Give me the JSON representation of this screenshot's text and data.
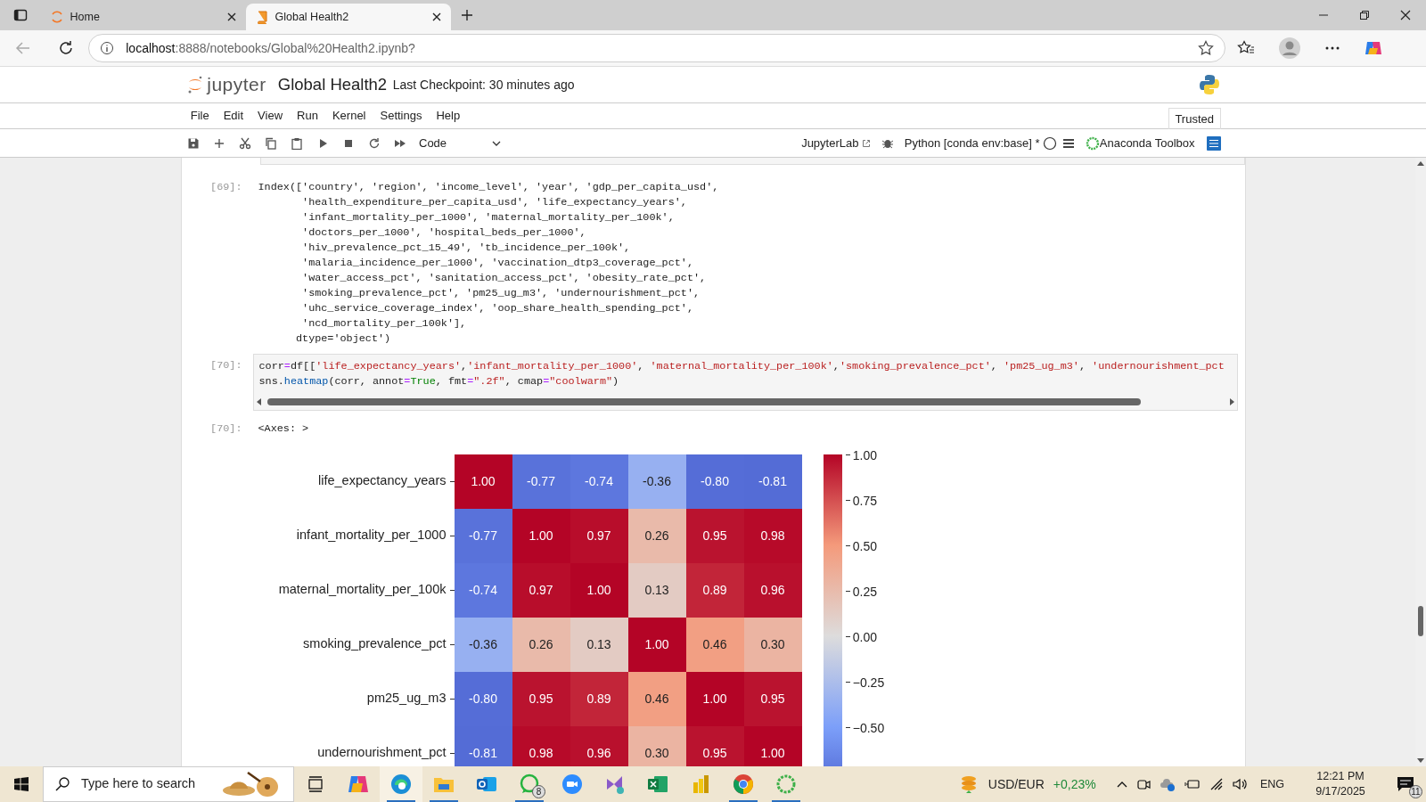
{
  "browser": {
    "tabs": [
      {
        "title": "Home",
        "selected": false
      },
      {
        "title": "Global Health2",
        "selected": true
      }
    ],
    "url_host": "localhost",
    "url_path": ":8888/notebooks/Global%20Health2.ipynb?"
  },
  "notebook": {
    "logo_text": "jupyter",
    "title": "Global Health2",
    "checkpoint": "Last Checkpoint: 30 minutes ago",
    "menu": [
      "File",
      "Edit",
      "View",
      "Run",
      "Kernel",
      "Settings",
      "Help"
    ],
    "trusted": "Trusted",
    "cell_type": "Code",
    "jupyterlab": "JupyterLab",
    "kernel": "Python [conda env:base] *",
    "toolbox": "Anaconda Toolbox"
  },
  "cells": [
    {
      "kind": "output",
      "prompt": "[69]:",
      "lines": [
        "Index(['country', 'region', 'income_level', 'year', 'gdp_per_capita_usd',",
        "       'health_expenditure_per_capita_usd', 'life_expectancy_years',",
        "       'infant_mortality_per_1000', 'maternal_mortality_per_100k',",
        "       'doctors_per_1000', 'hospital_beds_per_1000',",
        "       'hiv_prevalence_pct_15_49', 'tb_incidence_per_100k',",
        "       'malaria_incidence_per_1000', 'vaccination_dtp3_coverage_pct',",
        "       'water_access_pct', 'sanitation_access_pct', 'obesity_rate_pct',",
        "       'smoking_prevalence_pct', 'pm25_ug_m3', 'undernourishment_pct',",
        "       'uhc_service_coverage_index', 'oop_share_health_spending_pct',",
        "       'ncd_mortality_per_100k'],",
        "      dtype='object')"
      ]
    },
    {
      "kind": "code",
      "prompt": "[70]:",
      "lines": [
        [
          {
            "t": "corr",
            "kind": "plain"
          },
          {
            "t": "=",
            "kind": "operator"
          },
          {
            "t": "df[[",
            "kind": "plain"
          },
          {
            "t": "'life_expectancy_years'",
            "kind": "string"
          },
          {
            "t": ",",
            "kind": "plain"
          },
          {
            "t": "'infant_mortality_per_1000'",
            "kind": "string"
          },
          {
            "t": ", ",
            "kind": "plain"
          },
          {
            "t": "'maternal_mortality_per_100k'",
            "kind": "string"
          },
          {
            "t": ",",
            "kind": "plain"
          },
          {
            "t": "'smoking_prevalence_pct'",
            "kind": "string"
          },
          {
            "t": ", ",
            "kind": "plain"
          },
          {
            "t": "'pm25_ug_m3'",
            "kind": "string"
          },
          {
            "t": ", ",
            "kind": "plain"
          },
          {
            "t": "'undernourishment_pct",
            "kind": "string"
          }
        ],
        [
          {
            "t": "sns.",
            "kind": "plain"
          },
          {
            "t": "heatmap",
            "kind": "function"
          },
          {
            "t": "(corr, annot",
            "kind": "plain"
          },
          {
            "t": "=",
            "kind": "operator"
          },
          {
            "t": "True",
            "kind": "keyword"
          },
          {
            "t": ", fmt",
            "kind": "plain"
          },
          {
            "t": "=",
            "kind": "operator"
          },
          {
            "t": "\".2f\"",
            "kind": "string"
          },
          {
            "t": ", cmap",
            "kind": "plain"
          },
          {
            "t": "=",
            "kind": "operator"
          },
          {
            "t": "\"coolwarm\"",
            "kind": "string"
          },
          {
            "t": ")",
            "kind": "plain"
          }
        ]
      ]
    },
    {
      "kind": "output",
      "prompt": "[70]:",
      "lines": [
        "<Axes: >"
      ]
    }
  ],
  "heatmap": {
    "row_labels": [
      "life_expectancy_years",
      "infant_mortality_per_1000",
      "maternal_mortality_per_100k",
      "smoking_prevalence_pct",
      "pm25_ug_m3",
      "undernourishment_pct"
    ],
    "values": [
      [
        "1.00",
        "-0.77",
        "-0.74",
        "-0.36",
        "-0.80",
        "-0.81"
      ],
      [
        "-0.77",
        "1.00",
        "0.97",
        "0.26",
        "0.95",
        "0.98"
      ],
      [
        "-0.74",
        "0.97",
        "1.00",
        "0.13",
        "0.89",
        "0.96"
      ],
      [
        "-0.36",
        "0.26",
        "0.13",
        "1.00",
        "0.46",
        "0.30"
      ],
      [
        "-0.80",
        "0.95",
        "0.89",
        "0.46",
        "1.00",
        "0.95"
      ],
      [
        "-0.81",
        "0.98",
        "0.96",
        "0.30",
        "0.95",
        "1.00"
      ]
    ],
    "colorbar_ticks": [
      "1.00",
      "0.75",
      "0.50",
      "0.25",
      "0.00",
      "−0.25",
      "−0.50"
    ]
  },
  "taskbar": {
    "search_placeholder": "Type here to search",
    "apps": [
      {
        "kind": "copilot",
        "running": false
      },
      {
        "kind": "edge",
        "running": true
      },
      {
        "kind": "explorer",
        "running": true
      },
      {
        "kind": "outlook",
        "running": false
      },
      {
        "kind": "whatsapp",
        "running": true,
        "badge": "8"
      },
      {
        "kind": "zoom",
        "running": false
      },
      {
        "kind": "vs",
        "running": false
      },
      {
        "kind": "excel",
        "running": false
      },
      {
        "kind": "powerbi",
        "running": false
      },
      {
        "kind": "chrome",
        "running": true
      },
      {
        "kind": "anaconda",
        "running": true
      }
    ],
    "ticker": "USD/EUR",
    "change": "+0,23%",
    "language": "ENG",
    "time": "12:21 PM",
    "date": "9/17/2025",
    "notifications": "11"
  }
}
